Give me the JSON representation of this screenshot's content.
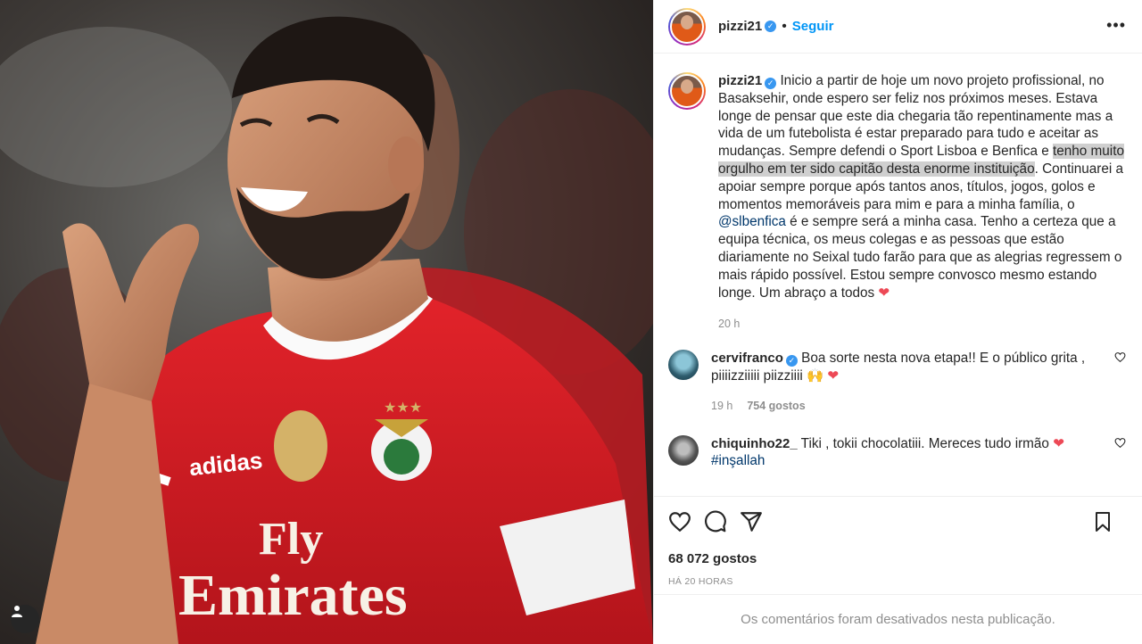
{
  "post": {
    "username": "pizzi21",
    "follow_label": "Seguir",
    "photo_alt": "Jogador do Benfica a sorrir",
    "jersey_sponsor_line1": "Fly",
    "jersey_sponsor_line2": "Emirates",
    "jersey_brand": "adidas"
  },
  "caption": {
    "username": "pizzi21",
    "part1": "Inicio a partir de hoje um novo projeto profissional, no Basaksehir, onde espero ser feliz nos próximos meses. Estava longe de pensar que este dia chegaria tão repentinamente mas a vida de um futebolista é estar preparado para tudo e aceitar as mudanças. Sempre defendi o Sport Lisboa e Benfica e ",
    "highlight": "tenho muito orgulho em ter sido capitão desta enorme instituição",
    "part2": ". Continuarei a apoiar sempre porque após tantos anos, títulos, jogos, golos e momentos memoráveis para mim e para a minha família, o ",
    "mention": "@slbenfica",
    "part3": " é e sempre será a minha casa. Tenho a certeza que a equipa técnica, os meus colegas e as pessoas que estão diariamente no Seixal tudo farão para que as alegrias regressem o mais rápido possível. Estou sempre convosco mesmo estando longe. Um abraço a todos ",
    "emoji": "❤",
    "time": "20 h"
  },
  "comments": [
    {
      "username": "cervifranco",
      "text": "Boa sorte nesta nova etapa!! E o público grita , piiiizziiiii piizziiii 🙌",
      "emoji": "❤",
      "time": "19 h",
      "likes": "754 gostos"
    },
    {
      "username": "chiquinho22_",
      "text": "Tiki , tokii chocolatiii. Mereces tudo irmão",
      "emoji": "❤",
      "hashtag": "#inşallah"
    }
  ],
  "stats": {
    "likes": "68 072 gostos",
    "posted": "HÁ 20 HORAS"
  },
  "footer": {
    "comments_disabled": "Os comentários foram desativados nesta publicação."
  },
  "icons": [
    "like-icon",
    "comment-icon",
    "share-icon",
    "save-icon",
    "more-options-icon",
    "verified-icon",
    "user-tag-icon"
  ],
  "colors": {
    "link": "#0095f6",
    "verified": "#3897f0",
    "heart": "#ed4956",
    "muted": "#8e8e8e",
    "jersey_red": "#e8262d"
  }
}
